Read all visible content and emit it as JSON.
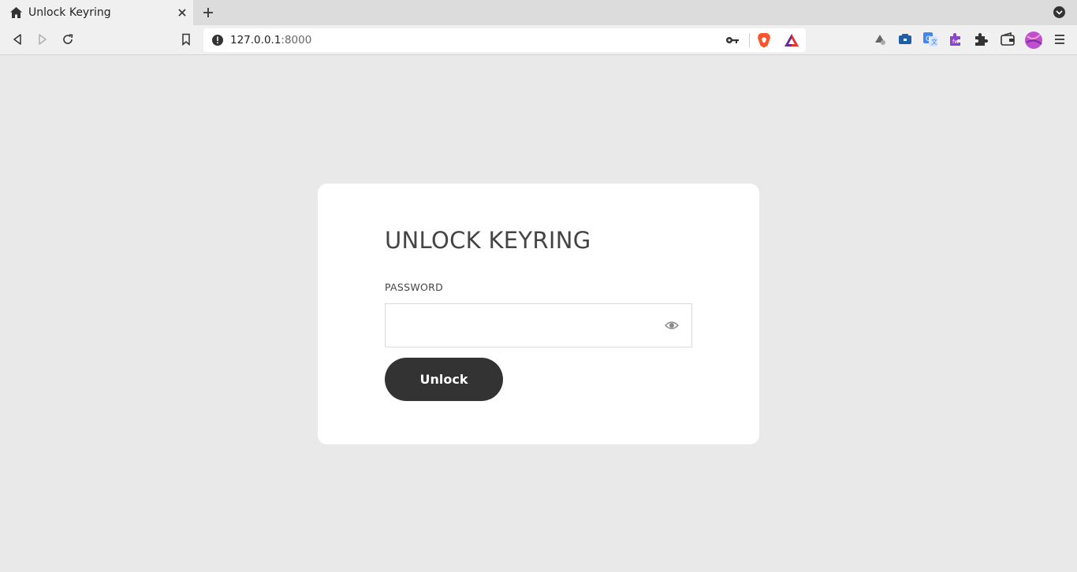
{
  "browser": {
    "tab": {
      "title": "Unlock Keyring"
    },
    "omnibox": {
      "host": "127.0.0.1",
      "port": ":8000"
    },
    "icons": [
      "home-icon",
      "close-icon",
      "plus-icon",
      "tab-list-dropdown-icon",
      "back-icon",
      "forward-icon",
      "reload-icon",
      "bookmark-icon",
      "info-icon",
      "key-icon",
      "brave-shields-icon",
      "brave-rewards-icon",
      "extension-icons",
      "puzzle-icon",
      "wallet-icon",
      "avatar",
      "menu-icon"
    ]
  },
  "page": {
    "card": {
      "title": "UNLOCK KEYRING",
      "password_label": "PASSWORD",
      "password_value": "",
      "unlock_label": "Unlock"
    }
  },
  "colors": {
    "page_bg": "#e9e9e9",
    "card_bg": "#ffffff",
    "button_bg": "#333333",
    "title_text": "#444444"
  }
}
